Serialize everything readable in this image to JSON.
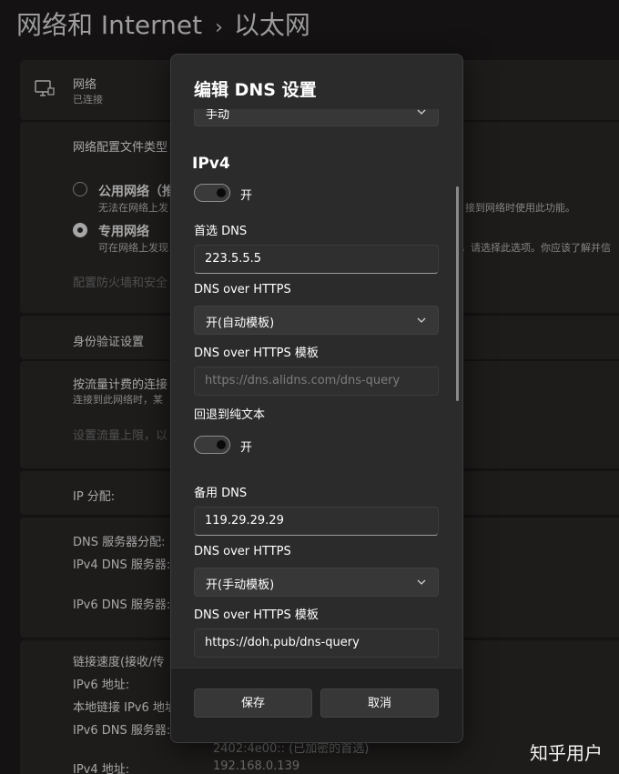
{
  "background": {
    "breadcrumb": {
      "parent": "网络和 Internet",
      "separator": "›",
      "current": "以太网"
    },
    "network": {
      "name": "网络",
      "status": "已连接"
    },
    "profile": {
      "heading": "网络配置文件类型",
      "public_label": "公用网络（推",
      "public_desc_left": "无法在网络上发",
      "public_desc_right": "接到网络时使用此功能。",
      "private_label": "专用网络",
      "private_desc_left": "可在网络上发现",
      "private_desc_right": "，请选择此选项。你应该了解并信",
      "firewall_link": "配置防火墙和安全"
    },
    "auth_settings": "身份验证设置",
    "metered": {
      "label": "按流量计费的连接",
      "desc": "连接到此网络时，某",
      "data_limit_link": "设置流量上限，以"
    },
    "ip_assignment": "IP 分配:",
    "dns": {
      "assignment": "DNS 服务器分配:",
      "ipv4": "IPv4 DNS 服务器:",
      "ipv6": "IPv6 DNS 服务器:"
    },
    "props": {
      "link_speed": "链接速度(接收/传",
      "ipv6_address": "IPv6 地址:",
      "link_local_ipv6": "本地链接 IPv6 地址",
      "ipv6_dns": "IPv6 DNS 服务器:",
      "ipv6_dns_value": "2402:4e00:: (已加密的首选)",
      "ipv4_address": "IPv4 地址:",
      "ipv4_address_value": "192.168.0.139"
    }
  },
  "dialog": {
    "title": "编辑 DNS 设置",
    "mode_value": "手动",
    "ipv4": {
      "heading": "IPv4",
      "toggle_label": "开",
      "preferred_dns_label": "首选 DNS",
      "preferred_dns_value": "223.5.5.5",
      "doh_label": "DNS over HTTPS",
      "doh_value": "开(自动模板)",
      "doh_template_label": "DNS over HTTPS 模板",
      "doh_template_placeholder": "https://dns.alidns.com/dns-query",
      "fallback_label": "回退到纯文本",
      "fallback_toggle_label": "开",
      "alternate_dns_label": "备用 DNS",
      "alternate_dns_value": "119.29.29.29",
      "alt_doh_label": "DNS over HTTPS",
      "alt_doh_value": "开(手动模板)",
      "alt_doh_template_label": "DNS over HTTPS 模板",
      "alt_doh_template_value": "https://doh.pub/dns-query"
    },
    "save_label": "保存",
    "cancel_label": "取消"
  },
  "watermark": "知乎用户"
}
